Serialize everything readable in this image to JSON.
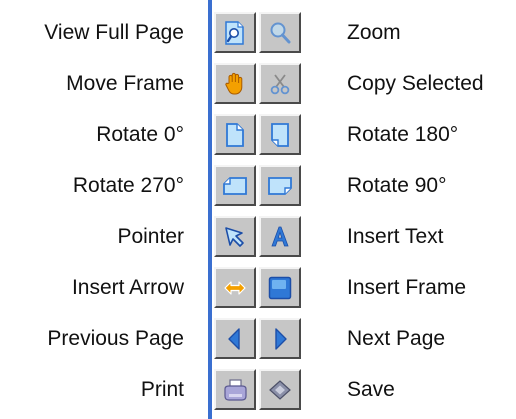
{
  "tools": [
    {
      "left_label": "View Full Page",
      "right_label": "Zoom",
      "left_icon": "view-full-page-icon",
      "right_icon": "zoom-icon"
    },
    {
      "left_label": "Move Frame",
      "right_label": "Copy Selected",
      "left_icon": "move-frame-icon",
      "right_icon": "copy-selected-icon"
    },
    {
      "left_label": "Rotate 0°",
      "right_label": "Rotate 180°",
      "left_icon": "rotate-0-icon",
      "right_icon": "rotate-180-icon"
    },
    {
      "left_label": "Rotate 270°",
      "right_label": "Rotate 90°",
      "left_icon": "rotate-270-icon",
      "right_icon": "rotate-90-icon"
    },
    {
      "left_label": "Pointer",
      "right_label": "Insert Text",
      "left_icon": "pointer-icon",
      "right_icon": "insert-text-icon"
    },
    {
      "left_label": "Insert Arrow",
      "right_label": "Insert Frame",
      "left_icon": "insert-arrow-icon",
      "right_icon": "insert-frame-icon"
    },
    {
      "left_label": "Previous Page",
      "right_label": "Next Page",
      "left_icon": "previous-page-icon",
      "right_icon": "next-page-icon"
    },
    {
      "left_label": "Print",
      "right_label": "Save",
      "left_icon": "print-icon",
      "right_icon": "save-icon"
    }
  ],
  "colors": {
    "toolbar_track": "#3a6fd0",
    "button_face": "#c6c6c6",
    "icon_blue": "#2f78d6",
    "icon_light_blue": "#bfe3fb",
    "icon_orange": "#f4a000"
  }
}
